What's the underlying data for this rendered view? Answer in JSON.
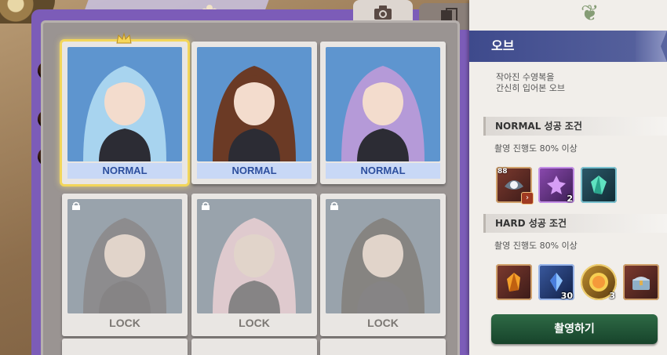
{
  "tabs": [
    {
      "icon": "camera-icon",
      "active": true
    },
    {
      "icon": "book-icon",
      "active": false
    }
  ],
  "cards": [
    {
      "label": "NORMAL",
      "state": "unlocked",
      "selected": true,
      "hair": "#a8d4ef"
    },
    {
      "label": "NORMAL",
      "state": "unlocked",
      "selected": false,
      "hair": "#6b3a25"
    },
    {
      "label": "NORMAL",
      "state": "unlocked",
      "selected": false,
      "hair": "#b59ad8"
    },
    {
      "label": "LOCK",
      "state": "locked",
      "selected": false,
      "hair": "#3a3c48"
    },
    {
      "label": "LOCK",
      "state": "locked",
      "selected": false,
      "hair": "#f0c6d6"
    },
    {
      "label": "LOCK",
      "state": "locked",
      "selected": false,
      "hair": "#2b2b2b"
    }
  ],
  "panel": {
    "title": "오브",
    "description": "작아진 수영복을\n간신히 입어본 오브",
    "normal": {
      "title": "NORMAL 성공 조건",
      "condition": "촬영 진행도 80% 이상",
      "rewards": [
        {
          "icon": "pearl-shell-icon",
          "level": "88",
          "count": ""
        },
        {
          "icon": "purple-flower-gem-icon",
          "level": "",
          "count": "2"
        },
        {
          "icon": "teal-crystal-icon",
          "level": "",
          "count": ""
        }
      ]
    },
    "hard": {
      "title": "HARD 성공 조건",
      "condition": "촬영 진행도 80% 이상",
      "rewards": [
        {
          "icon": "amber-crystal-icon",
          "count": ""
        },
        {
          "icon": "blue-gem-icon",
          "count": "30"
        },
        {
          "icon": "gold-medal-icon",
          "count": "3"
        },
        {
          "icon": "treasure-chest-icon",
          "count": ""
        }
      ]
    },
    "shoot_button": "촬영하기"
  },
  "colors": {
    "binder": "#7c5cb8",
    "header": "#3e4a8c",
    "button": "#2e6a45",
    "normal_label_bg": "#c8d8f6",
    "normal_label_text": "#2d4f9e"
  }
}
